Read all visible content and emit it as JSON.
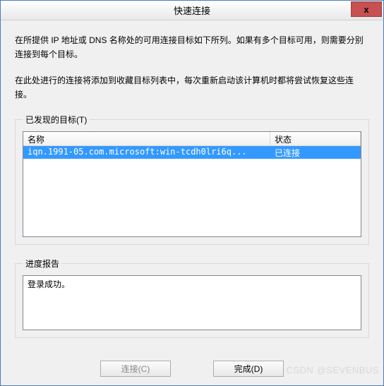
{
  "titlebar": {
    "title": "快速连接",
    "close_label": "x"
  },
  "info": {
    "line1": "在所提供 IP 地址或 DNS 名称处的可用连接目标如下所列。如果有多个目标可用，则需要分别连接到每个目标。",
    "line2": "在此处进行的连接将添加到收藏目标列表中，每次重新启动该计算机时都将尝试恢复这些连接。"
  },
  "targets": {
    "legend": "已发现的目标(T)",
    "columns": {
      "name": "名称",
      "status": "状态"
    },
    "rows": [
      {
        "name": "iqn.1991-05.com.microsoft:win-tcdh0lri6q...",
        "status": "已连接",
        "selected": true
      }
    ]
  },
  "progress": {
    "legend": "进度报告",
    "message": "登录成功。"
  },
  "buttons": {
    "connect": "连接(C)",
    "done": "完成(D)"
  },
  "watermark": "CSDN @SEVENBUS"
}
